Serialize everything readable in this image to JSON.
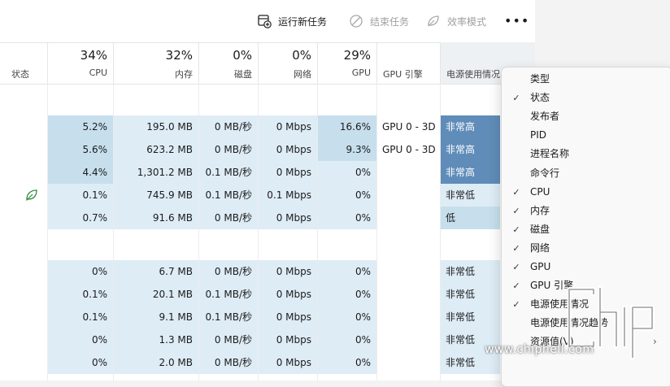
{
  "toolbar": {
    "run_task": "运行新任务",
    "end_task": "结束任务",
    "efficiency": "效率模式",
    "more": "•••"
  },
  "header": {
    "status": "状态",
    "cpu": {
      "pct": "34%",
      "label": "CPU"
    },
    "memory": {
      "pct": "32%",
      "label": "内存"
    },
    "disk": {
      "pct": "0%",
      "label": "磁盘"
    },
    "network": {
      "pct": "0%",
      "label": "网络"
    },
    "gpu": {
      "pct": "29%",
      "label": "GPU"
    },
    "gpu_engine": {
      "label": "GPU 引擎"
    },
    "power": {
      "label": "电源使用情况"
    }
  },
  "rows": [
    {
      "status_icon": "",
      "cpu": "",
      "memory": "",
      "disk": "",
      "network": "",
      "gpu": "",
      "gpu_engine": "",
      "power": ""
    },
    {
      "status_icon": "",
      "cpu": "5.2%",
      "memory": "195.0 MB",
      "disk": "0 MB/秒",
      "network": "0 Mbps",
      "gpu": "16.6%",
      "gpu_engine": "GPU 0 - 3D",
      "power": "非常高"
    },
    {
      "status_icon": "",
      "cpu": "5.6%",
      "memory": "623.2 MB",
      "disk": "0 MB/秒",
      "network": "0 Mbps",
      "gpu": "9.3%",
      "gpu_engine": "GPU 0 - 3D",
      "power": "非常高"
    },
    {
      "status_icon": "",
      "cpu": "4.4%",
      "memory": "1,301.2 MB",
      "disk": "0.1 MB/秒",
      "network": "0 Mbps",
      "gpu": "0%",
      "gpu_engine": "",
      "power": "非常高"
    },
    {
      "status_icon": "leaf",
      "cpu": "0.1%",
      "memory": "745.9 MB",
      "disk": "0.1 MB/秒",
      "network": "0.1 Mbps",
      "gpu": "0%",
      "gpu_engine": "",
      "power": "非常低"
    },
    {
      "status_icon": "",
      "cpu": "0.7%",
      "memory": "91.6 MB",
      "disk": "0 MB/秒",
      "network": "0 Mbps",
      "gpu": "0%",
      "gpu_engine": "",
      "power": "低"
    },
    {
      "status_icon": "",
      "cpu": "",
      "memory": "",
      "disk": "",
      "network": "",
      "gpu": "",
      "gpu_engine": "",
      "power": ""
    },
    {
      "status_icon": "",
      "cpu": "0%",
      "memory": "6.7 MB",
      "disk": "0 MB/秒",
      "network": "0 Mbps",
      "gpu": "0%",
      "gpu_engine": "",
      "power": "非常低"
    },
    {
      "status_icon": "",
      "cpu": "0.1%",
      "memory": "20.1 MB",
      "disk": "0.1 MB/秒",
      "network": "0 Mbps",
      "gpu": "0%",
      "gpu_engine": "",
      "power": "非常低"
    },
    {
      "status_icon": "",
      "cpu": "0.1%",
      "memory": "9.1 MB",
      "disk": "0.1 MB/秒",
      "network": "0 Mbps",
      "gpu": "0%",
      "gpu_engine": "",
      "power": "非常低"
    },
    {
      "status_icon": "",
      "cpu": "0%",
      "memory": "1.3 MB",
      "disk": "0 MB/秒",
      "network": "0 Mbps",
      "gpu": "0%",
      "gpu_engine": "",
      "power": "非常低"
    },
    {
      "status_icon": "",
      "cpu": "0%",
      "memory": "2.0 MB",
      "disk": "0 MB/秒",
      "network": "0 Mbps",
      "gpu": "0%",
      "gpu_engine": "",
      "power": "非常低"
    }
  ],
  "menu": [
    {
      "label": "类型",
      "checked": false,
      "submenu": false
    },
    {
      "label": "状态",
      "checked": true,
      "submenu": false
    },
    {
      "label": "发布者",
      "checked": false,
      "submenu": false
    },
    {
      "label": "PID",
      "checked": false,
      "submenu": false
    },
    {
      "label": "进程名称",
      "checked": false,
      "submenu": false
    },
    {
      "label": "命令行",
      "checked": false,
      "submenu": false
    },
    {
      "label": "CPU",
      "checked": true,
      "submenu": false
    },
    {
      "label": "内存",
      "checked": true,
      "submenu": false
    },
    {
      "label": "磁盘",
      "checked": true,
      "submenu": false
    },
    {
      "label": "网络",
      "checked": true,
      "submenu": false
    },
    {
      "label": "GPU",
      "checked": true,
      "submenu": false
    },
    {
      "label": "GPU 引擎",
      "checked": true,
      "submenu": false
    },
    {
      "label": "电源使用情况",
      "checked": true,
      "submenu": false
    },
    {
      "label": "电源使用情况趋势",
      "checked": false,
      "submenu": false
    },
    {
      "label": "资源值(V)",
      "checked": false,
      "submenu": true
    }
  ],
  "watermark": {
    "site": "www.chiphell.com"
  },
  "colors": {
    "heat_light": "#deecf6",
    "heat_medium": "#c7dfed",
    "heat_strong": "#5f8cb8",
    "leaf_green": "#2e8b3c"
  }
}
